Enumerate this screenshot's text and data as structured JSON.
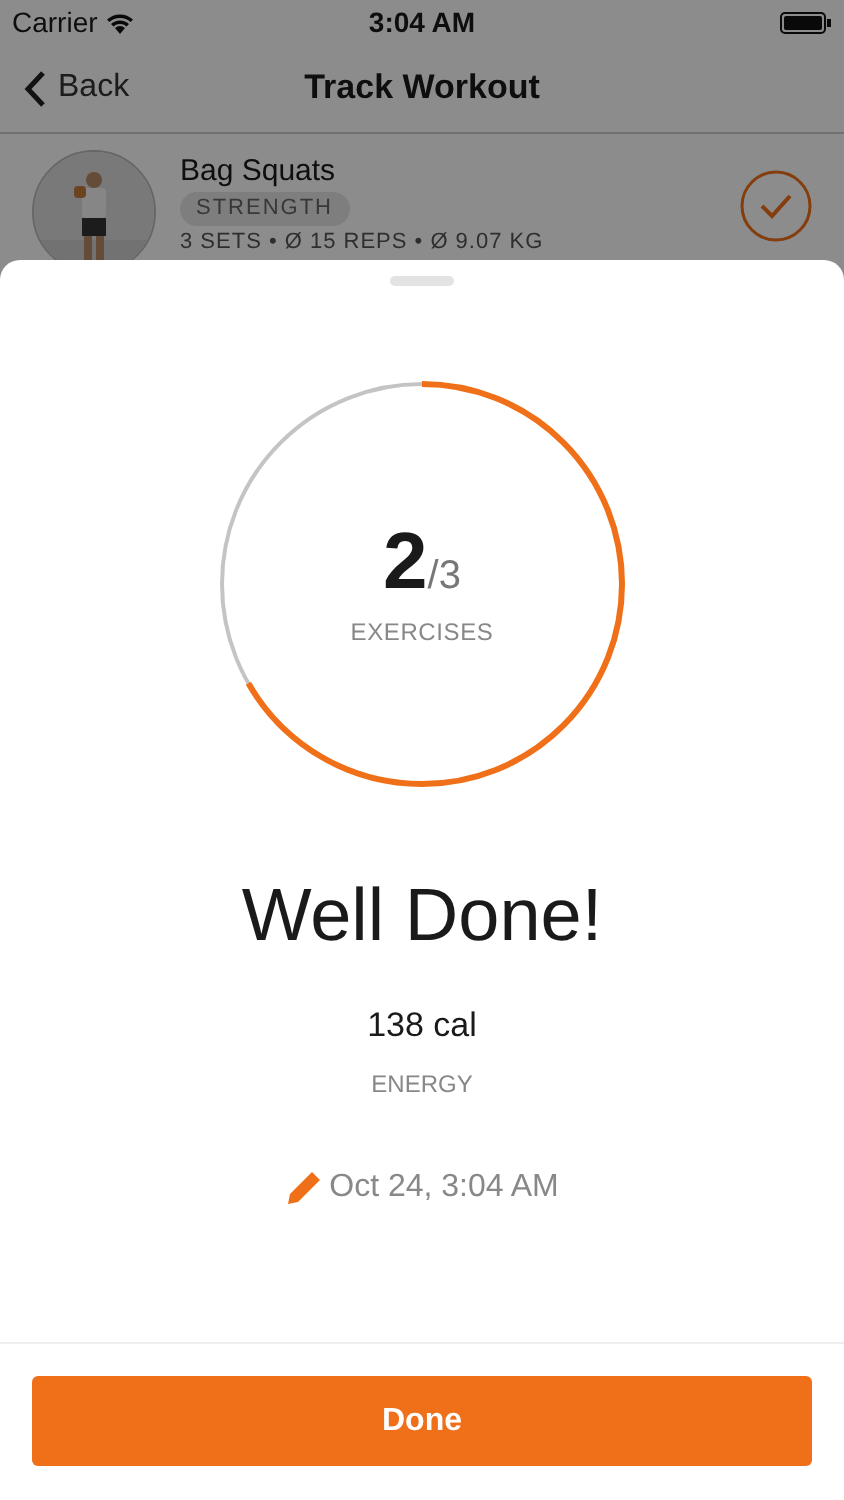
{
  "status_bar": {
    "carrier": "Carrier",
    "time": "3:04 AM"
  },
  "nav": {
    "back": "Back",
    "title": "Track Workout"
  },
  "exercise": {
    "name": "Bag Squats",
    "tag": "STRENGTH",
    "details": "3 SETS • Ø 15 REPS • Ø 9.07 KG",
    "completed": true
  },
  "summary": {
    "done_count": "2",
    "total": "/3",
    "level": 0.667,
    "unit_label": "EXERCISES",
    "headline": "Well Done!",
    "energy": "138 cal",
    "energy_label": "ENERGY",
    "date": "Oct 24, 3:04 AM"
  },
  "button": "Done"
}
